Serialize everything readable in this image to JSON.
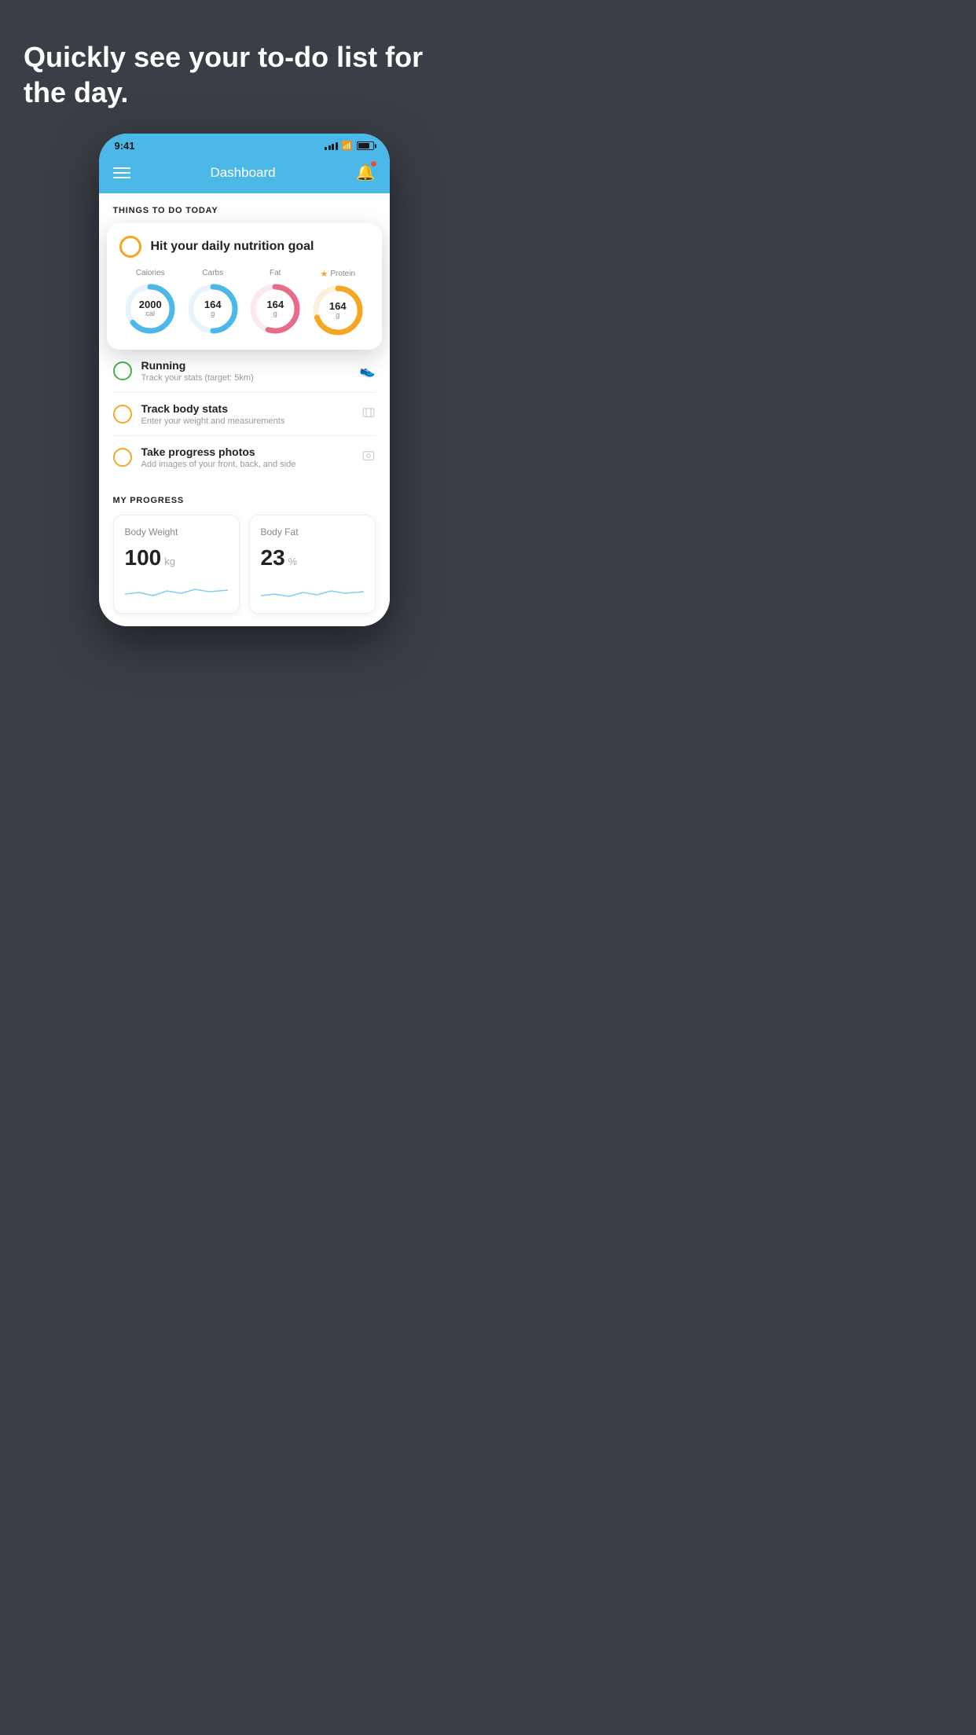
{
  "hero": {
    "title": "Quickly see your to-do list for the day."
  },
  "status_bar": {
    "time": "9:41"
  },
  "header": {
    "title": "Dashboard"
  },
  "things_today": {
    "label": "THINGS TO DO TODAY"
  },
  "nutrition_card": {
    "title": "Hit your daily nutrition goal",
    "stats": [
      {
        "label": "Calories",
        "value": "2000",
        "unit": "cal",
        "color": "#4cb8e8",
        "pct": 65
      },
      {
        "label": "Carbs",
        "value": "164",
        "unit": "g",
        "color": "#4cb8e8",
        "pct": 50
      },
      {
        "label": "Fat",
        "value": "164",
        "unit": "g",
        "color": "#e86b8a",
        "pct": 55
      },
      {
        "label": "Protein",
        "value": "164",
        "unit": "g",
        "color": "#f5a623",
        "pct": 70,
        "starred": true
      }
    ]
  },
  "todo_items": [
    {
      "title": "Running",
      "subtitle": "Track your stats (target: 5km)",
      "circle_color": "green",
      "icon": "👟"
    },
    {
      "title": "Track body stats",
      "subtitle": "Enter your weight and measurements",
      "circle_color": "yellow",
      "icon": "⊡"
    },
    {
      "title": "Take progress photos",
      "subtitle": "Add images of your front, back, and side",
      "circle_color": "yellow",
      "icon": "👤"
    }
  ],
  "progress": {
    "label": "MY PROGRESS",
    "cards": [
      {
        "title": "Body Weight",
        "value": "100",
        "unit": "kg"
      },
      {
        "title": "Body Fat",
        "value": "23",
        "unit": "%"
      }
    ]
  }
}
